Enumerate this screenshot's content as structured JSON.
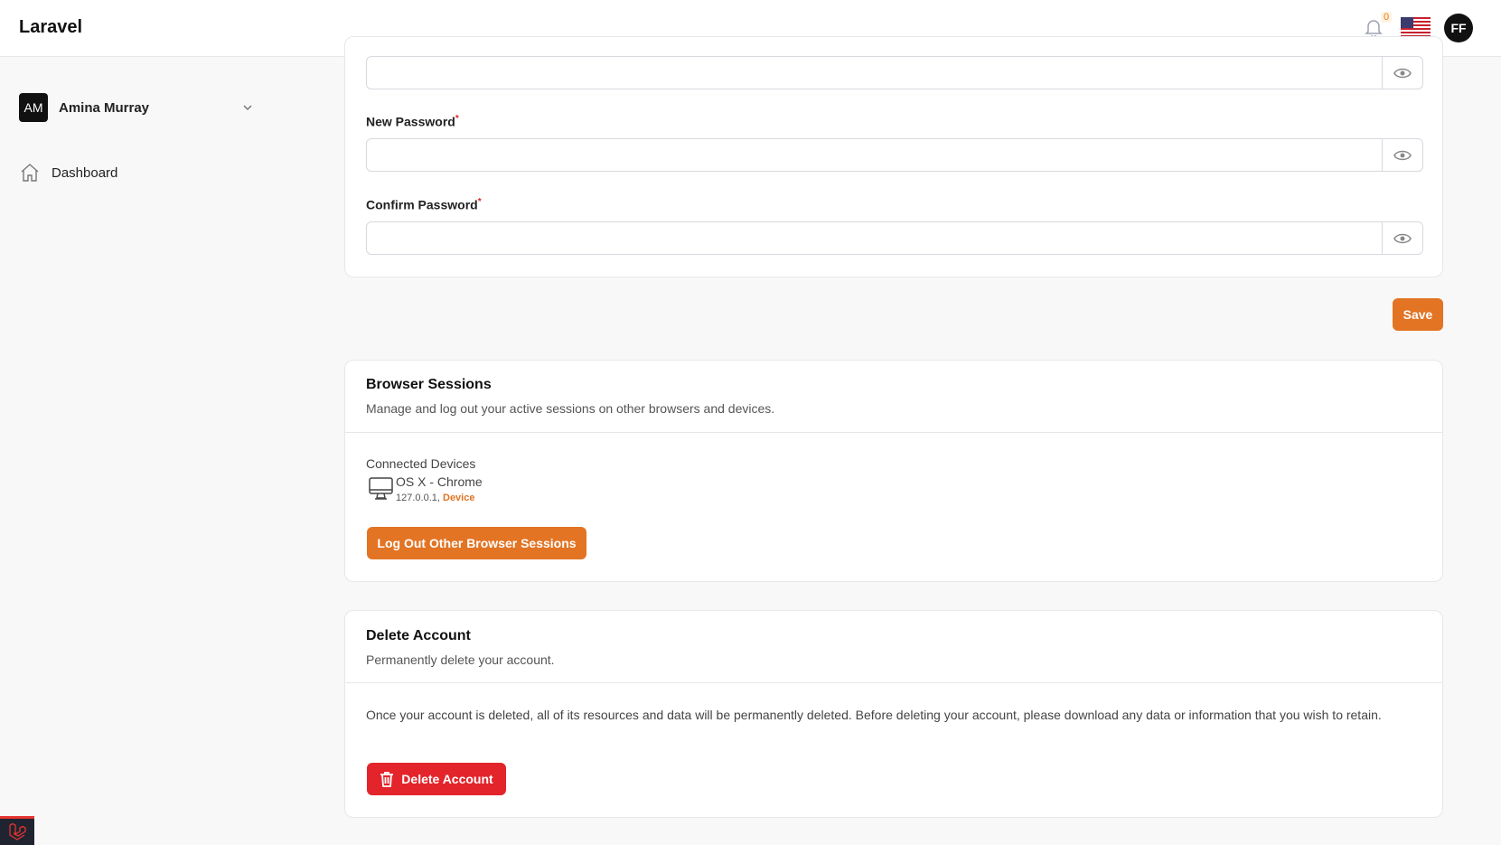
{
  "header": {
    "brand": "Laravel",
    "notification_count": "0",
    "user_initials": "FF",
    "flag_icon": "us-flag-icon"
  },
  "sidebar": {
    "user_initials": "AM",
    "user_name": "Amina Murray",
    "items": [
      {
        "label": "Dashboard",
        "icon": "home-icon"
      }
    ]
  },
  "password_form": {
    "new_password_label": "New Password",
    "confirm_password_label": "Confirm Password",
    "required_mark": "*",
    "save_label": "Save"
  },
  "browser_sessions": {
    "title": "Browser Sessions",
    "description": "Manage and log out your active sessions on other browsers and devices.",
    "connected_label": "Connected Devices",
    "device_name": "OS X - Chrome",
    "device_ip": "127.0.0.1,",
    "device_tag": "Device",
    "logout_label": "Log Out Other Browser Sessions"
  },
  "delete_account": {
    "title": "Delete Account",
    "description": "Permanently delete your account.",
    "warning": "Once your account is deleted, all of its resources and data will be permanently deleted. Before deleting your account, please download any data or information that you wish to retain.",
    "button_label": "Delete Account"
  },
  "colors": {
    "accent": "#e27424",
    "danger": "#e3242b"
  }
}
